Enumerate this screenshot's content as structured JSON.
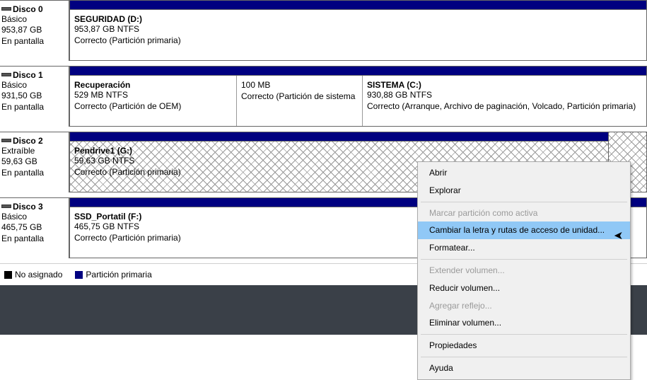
{
  "disks": [
    {
      "name": "Disco 0",
      "type": "Básico",
      "size": "953,87 GB",
      "status": "En pantalla",
      "partitions": [
        {
          "title": "SEGURIDAD  (D:)",
          "line2": "953,87 GB NTFS",
          "line3": "Correcto (Partición primaria)"
        }
      ]
    },
    {
      "name": "Disco 1",
      "type": "Básico",
      "size": "931,50 GB",
      "status": "En pantalla",
      "partitions": [
        {
          "title": "Recuperación",
          "line2": "529 MB NTFS",
          "line3": "Correcto (Partición de OEM)"
        },
        {
          "title": "",
          "line2": "100 MB",
          "line3": "Correcto (Partición de sistema"
        },
        {
          "title": "SISTEMA  (C:)",
          "line2": "930,88 GB NTFS",
          "line3": "Correcto (Arranque, Archivo de paginación, Volcado, Partición primaria)"
        }
      ]
    },
    {
      "name": "Disco 2",
      "type": "Extraíble",
      "size": "59,63 GB",
      "status": "En pantalla",
      "partitions": [
        {
          "title": "Pendrive1  (G:)",
          "line2": "59,63 GB NTFS",
          "line3": "Correcto (Partición primaria)"
        }
      ]
    },
    {
      "name": "Disco 3",
      "type": "Básico",
      "size": "465,75 GB",
      "status": "En pantalla",
      "partitions": [
        {
          "title": "SSD_Portatil  (F:)",
          "line2": "465,75 GB NTFS",
          "line3": "Correcto (Partición primaria)"
        }
      ]
    }
  ],
  "legend": {
    "unallocated": "No asignado",
    "primary": "Partición primaria"
  },
  "menu": {
    "open": "Abrir",
    "explore": "Explorar",
    "mark_active": "Marcar partición como activa",
    "change_letter": "Cambiar la letra y rutas de acceso de unidad...",
    "format": "Formatear...",
    "extend": "Extender volumen...",
    "shrink": "Reducir volumen...",
    "mirror": "Agregar reflejo...",
    "delete": "Eliminar volumen...",
    "properties": "Propiedades",
    "help": "Ayuda"
  }
}
